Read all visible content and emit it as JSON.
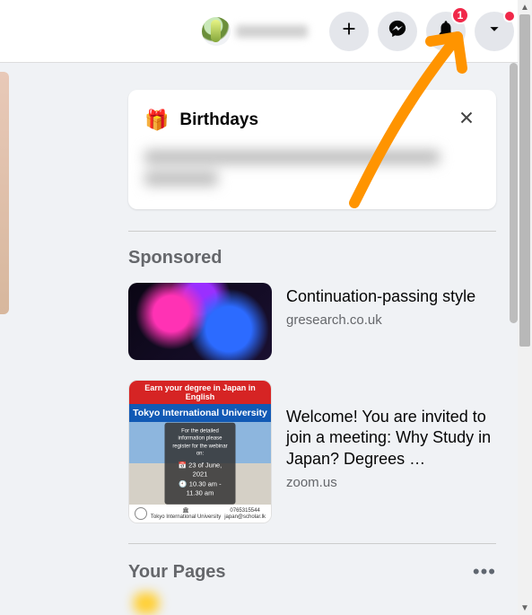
{
  "topbar": {
    "profile_name": "",
    "notification_count": "1"
  },
  "birthdays": {
    "icon": "🎁",
    "title": "Birthdays"
  },
  "sponsored": {
    "heading": "Sponsored",
    "ads": [
      {
        "title": "Continuation-passing style",
        "domain": "gresearch.co.uk"
      },
      {
        "title": "Welcome! You are invited to join a meeting: Why Study in Japan? Degrees …",
        "domain": "zoom.us"
      }
    ]
  },
  "ad2_image": {
    "line_red": "Earn your degree in Japan in English",
    "line_blue": "Tokyo International University",
    "info_line1": "For the detailed information please register for the webinar on:",
    "date": "23 of June, 2021",
    "time": "10.30 am - 11.30 am",
    "phone": "0765315544",
    "email": "japan@scholar.lk",
    "uni": "Tokyo International University"
  },
  "your_pages": {
    "heading": "Your Pages"
  }
}
